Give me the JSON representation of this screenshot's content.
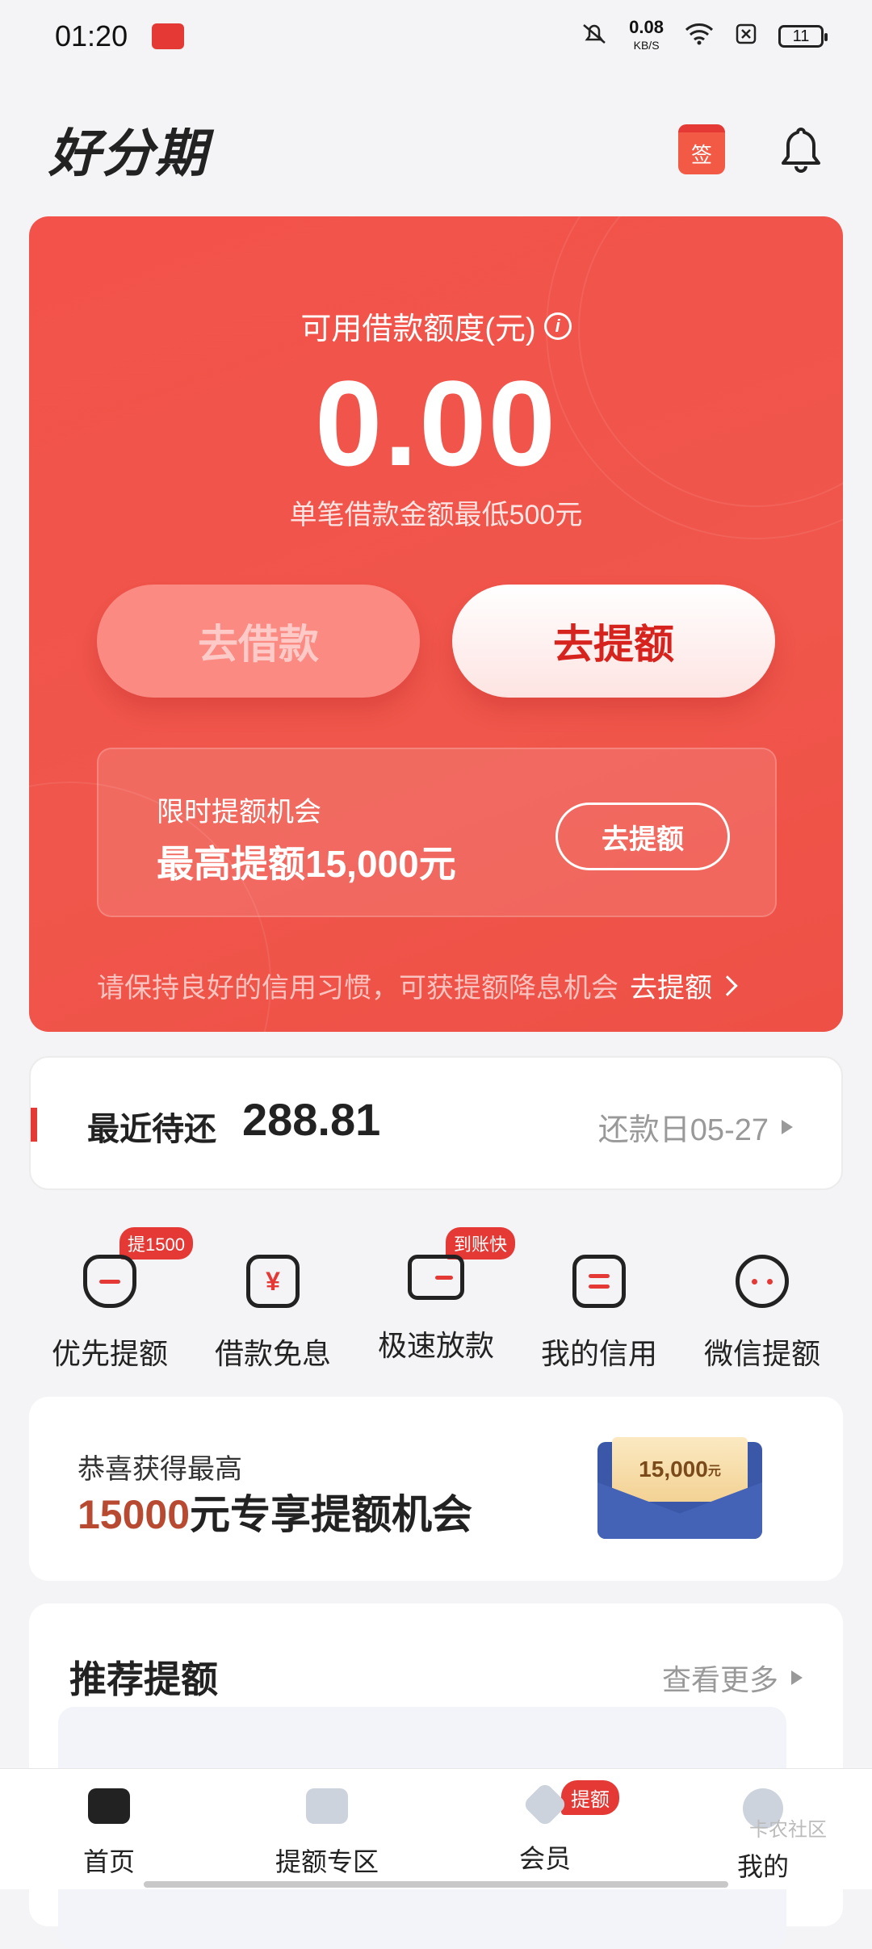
{
  "status_bar": {
    "time": "01:20",
    "net_speed_value": "0.08",
    "net_speed_unit": "KB/S",
    "battery": "11"
  },
  "header": {
    "logo": "好分期",
    "sign_label": "签"
  },
  "hero": {
    "credit_label": "可用借款额度(元)",
    "credit_amount": "0.00",
    "min_loan_text": "单笔借款金额最低500元",
    "borrow_button": "去借款",
    "raise_button": "去提额",
    "promo": {
      "line1": "限时提额机会",
      "line2": "最高提额15,000元",
      "button": "去提额"
    },
    "tip_text": "请保持良好的信用习惯，可获提额降息机会",
    "tip_link": "去提额"
  },
  "repay": {
    "label": "最近待还",
    "amount": "288.81",
    "date": "还款日05-27"
  },
  "quick_actions": [
    {
      "label": "优先提额",
      "badge": "提1500"
    },
    {
      "label": "借款免息",
      "badge": ""
    },
    {
      "label": "极速放款",
      "badge": "到账快"
    },
    {
      "label": "我的信用",
      "badge": ""
    },
    {
      "label": "微信提额",
      "badge": ""
    }
  ],
  "banner": {
    "line1": "恭喜获得最高",
    "highlight": "15000",
    "line2_rest": "元专享提额机会",
    "card_amount": "15,000",
    "card_unit": "元"
  },
  "recommend": {
    "title": "推荐提额",
    "more": "查看更多"
  },
  "tabbar": [
    {
      "label": "首页",
      "badge": ""
    },
    {
      "label": "提额专区",
      "badge": ""
    },
    {
      "label": "会员",
      "badge": "提额"
    },
    {
      "label": "我的",
      "badge": ""
    }
  ],
  "watermark": "卡农社区"
}
